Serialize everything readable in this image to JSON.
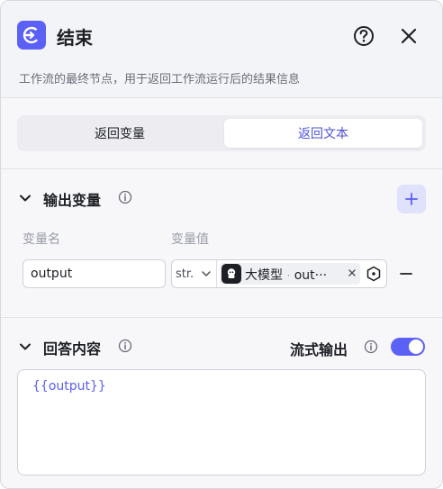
{
  "header": {
    "title": "结束",
    "description": "工作流的最终节点，用于返回工作流运行后的结果信息",
    "icons": {
      "logo": "end-node-icon",
      "help": "question-circle-icon",
      "close": "close-icon"
    }
  },
  "tabs": [
    {
      "label": "返回变量",
      "active": false
    },
    {
      "label": "返回文本",
      "active": true
    }
  ],
  "output_vars": {
    "title": "输出变量",
    "col_name": "变量名",
    "col_value": "变量值",
    "rows": [
      {
        "name": "output",
        "type": "str.",
        "ref_node": "大模型",
        "ref_sep": "·",
        "ref_var": "out···"
      }
    ]
  },
  "answer": {
    "title": "回答内容",
    "stream_label": "流式输出",
    "stream_enabled": true,
    "content": "{{output}}"
  },
  "colors": {
    "accent": "#5b60f6",
    "accent_text": "#4e52d8"
  }
}
